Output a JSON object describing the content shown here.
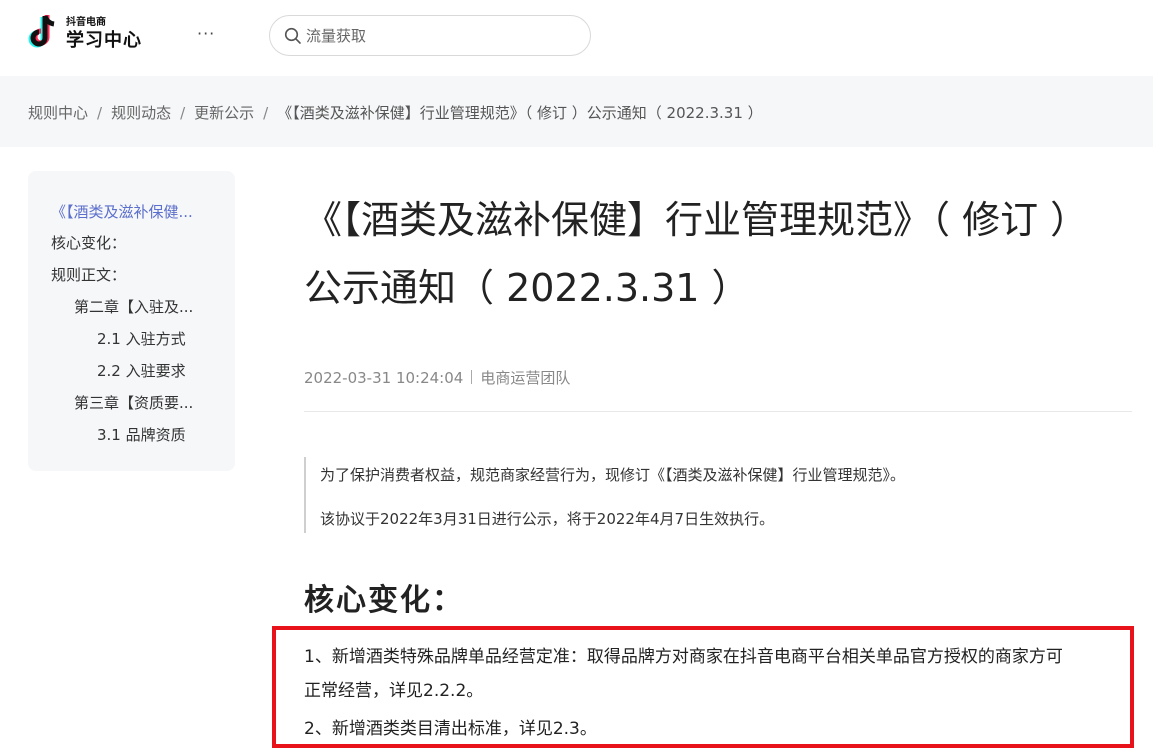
{
  "header": {
    "logo_sub": "抖音电商",
    "logo_main": "学习中心",
    "more": "···",
    "search_placeholder": "流量获取"
  },
  "breadcrumb": {
    "items": [
      "规则中心",
      "规则动态",
      "更新公示",
      "《【酒类及滋补保健】行业管理规范》（ 修订 ）公示通知（ 2022.3.31 ）"
    ],
    "separator": "/"
  },
  "toc": {
    "items": [
      "《【酒类及滋补保健...",
      "核心变化：",
      "规则正文：",
      "第二章【入驻及...",
      "2.1 入驻方式",
      "2.2 入驻要求",
      "第三章【资质要...",
      "3.1 品牌资质"
    ]
  },
  "article": {
    "title_line1": "《【酒类及滋补保健】行业管理规范》（ 修订 ）",
    "title_line2": "公示通知（ 2022.3.31 ）",
    "date": "2022-03-31 10:24:04",
    "author": "电商运营团队",
    "quote_line1": "为了保护消费者权益，规范商家经营行为，现修订《【酒类及滋补保健】行业管理规范》。",
    "quote_line2": "该协议于2022年3月31日进行公示，将于2022年4月7日生效执行。",
    "section_heading": "核心变化：",
    "change_1a": "1、新增酒类特殊品牌单品经营定准：取得品牌方对商家在抖音电商平台相关单品官方授权的商家方可",
    "change_1b": "正常经营，详见2.2.2。",
    "change_2": "2、新增酒类类目清出标准，详见2.3。"
  },
  "colors": {
    "accent": "#5b6fcc",
    "highlight_border": "#e8121b",
    "panel_bg": "#f6f7f9"
  }
}
